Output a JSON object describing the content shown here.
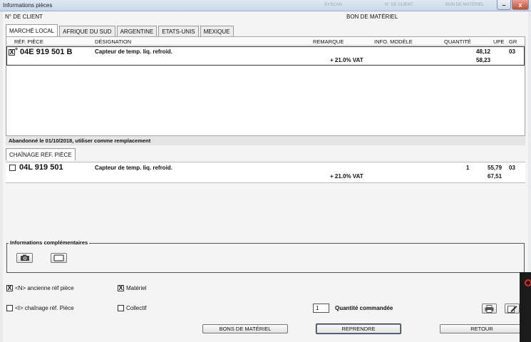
{
  "window": {
    "title": "Informations pièces",
    "ghost_labels": [
      "SYSCAN",
      "N° DE CLIENT",
      "BON DE MATÉRIEL"
    ],
    "buttons": {
      "minimize": "–",
      "close": "x"
    }
  },
  "header": {
    "client_label": "N° DE CLIENT",
    "order_label": "BON DE MATÉRIEL"
  },
  "tabs": [
    {
      "label": "MARCHÉ LOCAL",
      "active": true
    },
    {
      "label": "AFRIQUE DU SUD",
      "active": false
    },
    {
      "label": "ARGENTINE",
      "active": false
    },
    {
      "label": "ETATS-UNIS",
      "active": false
    },
    {
      "label": "MEXIQUE",
      "active": false
    }
  ],
  "columns": {
    "ref": "RÉF. PIÈCE",
    "designation": "DÉSIGNATION",
    "remark": "REMARQUE",
    "model_info": "INFO. MODÈLE",
    "quantity": "QUANTITÉ",
    "upe": "UPE",
    "gr": "GR"
  },
  "main_part": {
    "checked": "X",
    "flag": "°",
    "ref": "04E 919 501 B",
    "designation": "Capteur de temp. liq. refroid.",
    "price": "48,12",
    "gr": "03",
    "vat_label": "+ 21.0% VAT",
    "price_vat": "58,23"
  },
  "notice": "Abandonné le 01/10/2018, utiliser comme remplacement",
  "chain_tab": "CHAÎNAGE RÉF. PIÈCE",
  "chain_part": {
    "ref": "04L 919 501",
    "designation": "Capteur de temp. liq. refroid.",
    "quantity": "1",
    "price": "55,79",
    "gr": "03",
    "vat_label": "+ 21.0% VAT",
    "price_vat": "67,51"
  },
  "extra_info": {
    "legend": "Informations complémentaires"
  },
  "options": {
    "old_ref": {
      "checked": "X",
      "label": "<N> ancienne réf pièce"
    },
    "material": {
      "checked": "X",
      "label": "Matériel"
    },
    "chain_ref": {
      "checked": "",
      "label": "<I> chaînage réf. Pièce"
    },
    "collective": {
      "checked": "",
      "label": "Collectif"
    }
  },
  "quantity": {
    "value": "1",
    "label": "Quantité commandée"
  },
  "actions": {
    "bons": "BONS DE MATÉRIEL",
    "reprendre": "REPRENDRE",
    "retour": "RETOUR"
  },
  "colors": {
    "titlebar": "#c9d7ea",
    "close": "#c6492f",
    "panel": "#ffffff",
    "accent_mark": "#d8322a"
  }
}
